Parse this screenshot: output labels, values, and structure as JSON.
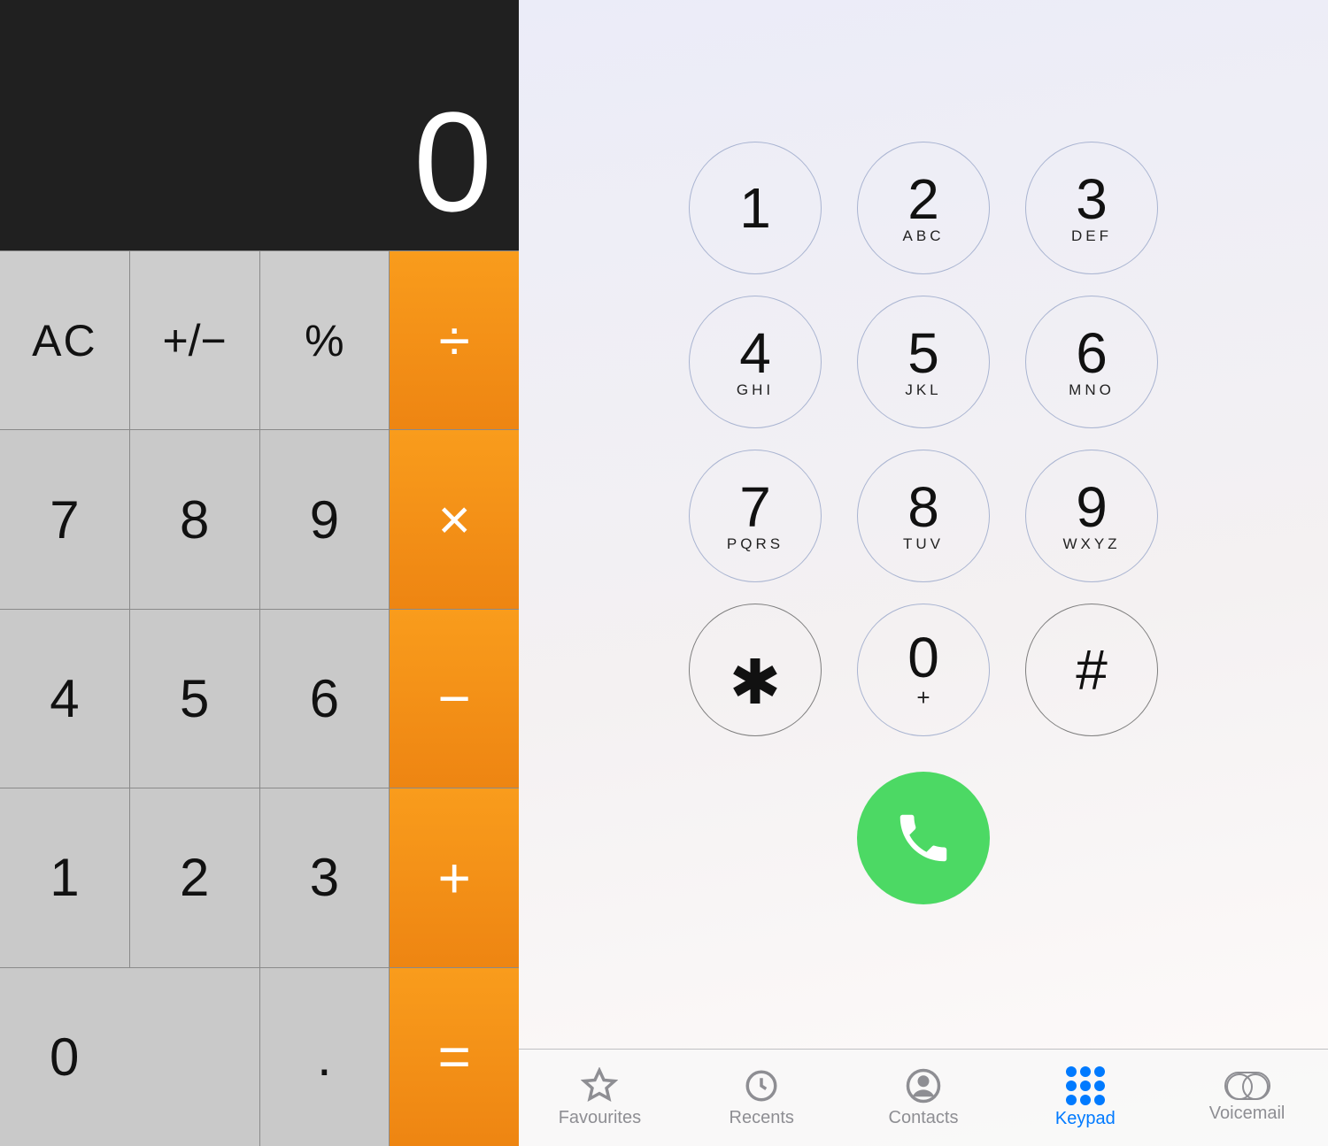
{
  "calculator": {
    "display": "0",
    "buttons": {
      "ac": "AC",
      "sign": "+/−",
      "percent": "%",
      "divide": "÷",
      "seven": "7",
      "eight": "8",
      "nine": "9",
      "multiply": "×",
      "four": "4",
      "five": "5",
      "six": "6",
      "minus": "−",
      "one": "1",
      "two": "2",
      "three": "3",
      "plus": "+",
      "zero": "0",
      "decimal": ".",
      "equals": "="
    }
  },
  "phone": {
    "keys": [
      {
        "digit": "1",
        "sub": ""
      },
      {
        "digit": "2",
        "sub": "ABC"
      },
      {
        "digit": "3",
        "sub": "DEF"
      },
      {
        "digit": "4",
        "sub": "GHI"
      },
      {
        "digit": "5",
        "sub": "JKL"
      },
      {
        "digit": "6",
        "sub": "MNO"
      },
      {
        "digit": "7",
        "sub": "PQRS"
      },
      {
        "digit": "8",
        "sub": "TUV"
      },
      {
        "digit": "9",
        "sub": "WXYZ"
      },
      {
        "digit": "✱",
        "sub": ""
      },
      {
        "digit": "0",
        "sub": "+"
      },
      {
        "digit": "#",
        "sub": ""
      }
    ],
    "call_button_color": "#4cd964",
    "tabs": {
      "favourites": "Favourites",
      "recents": "Recents",
      "contacts": "Contacts",
      "keypad": "Keypad",
      "voicemail": "Voicemail"
    },
    "active_tab": "keypad"
  }
}
